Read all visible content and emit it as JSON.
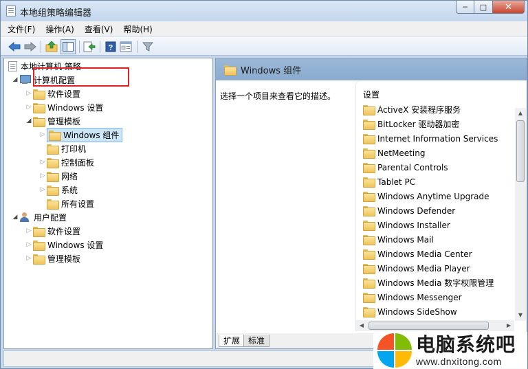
{
  "window": {
    "title": "本地组策略编辑器"
  },
  "menu": [
    "文件(F)",
    "操作(A)",
    "查看(V)",
    "帮助(H)"
  ],
  "toolbar": {
    "buttons": [
      "back-icon",
      "forward-icon",
      "up-folder-icon",
      "show-hide-tree-icon",
      "export-list-icon",
      "help-icon",
      "properties-icon",
      "filter-icon"
    ]
  },
  "tree": {
    "root": "本地计算机 策略",
    "computer_config": "计算机配置",
    "cc_software": "软件设置",
    "cc_windows": "Windows 设置",
    "cc_admin": "管理模板",
    "cc_admin_components": "Windows 组件",
    "cc_admin_printers": "打印机",
    "cc_admin_control_panel": "控制面板",
    "cc_admin_network": "网络",
    "cc_admin_system": "系统",
    "cc_admin_all": "所有设置",
    "user_config": "用户配置",
    "uc_software": "软件设置",
    "uc_windows": "Windows 设置",
    "uc_admin": "管理模板"
  },
  "details": {
    "header": "Windows 组件",
    "description": "选择一个项目来查看它的描述。",
    "column": "设置",
    "items": [
      "ActiveX 安装程序服务",
      "BitLocker 驱动器加密",
      "Internet Information Services",
      "NetMeeting",
      "Parental Controls",
      "Tablet PC",
      "Windows Anytime Upgrade",
      "Windows Defender",
      "Windows Installer",
      "Windows Mail",
      "Windows Media Center",
      "Windows Media Player",
      "Windows Media 数字权限管理",
      "Windows Messenger",
      "Windows SideShow"
    ]
  },
  "tabs": [
    "扩展",
    "标准"
  ],
  "watermark": {
    "name": "电脑系统吧",
    "url": "www.dnxitong.com"
  },
  "colors": {
    "highlight_box": "#e02020",
    "pane_header": "#8fb0d3",
    "folder": "#f2c85f"
  }
}
